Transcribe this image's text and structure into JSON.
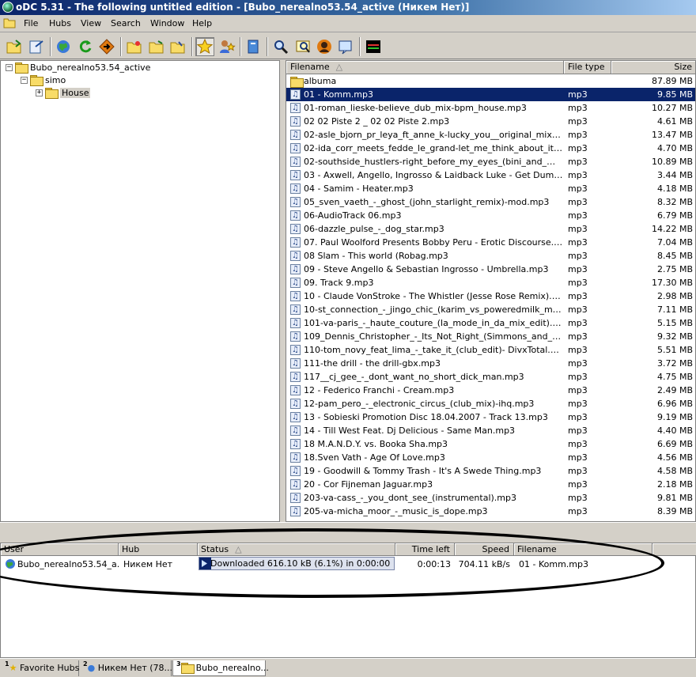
{
  "window": {
    "title": "oDC 5.31 - The following untitled edition - [Bubo_nerealno53.54_active (Никем Нет)]"
  },
  "menu": [
    "File",
    "Hubs",
    "View",
    "Search",
    "Window",
    "Help"
  ],
  "toolbar": {
    "buttons": [
      "connect-icon",
      "reconnect-icon",
      "public-hubs-icon",
      "refresh-icon",
      "follow-redirect-icon",
      "open-folder-icon",
      "open-file-list-icon",
      "open-own-list-icon",
      "favorite-hubs-icon",
      "favorite-users-icon",
      "queue-icon",
      "search-icon",
      "spy-icon",
      "avatar-icon",
      "notepad-icon",
      "network-stats-icon"
    ],
    "pressed": "favorite-hubs-icon"
  },
  "tree": {
    "root": "Bubo_nerealno53.54_active",
    "child": "simo",
    "grandchild": "House"
  },
  "files": {
    "headers": {
      "name": "Filename",
      "type": "File type",
      "size": "Size"
    },
    "rows": [
      {
        "name": "albuma",
        "type": "",
        "size": "87.89 MB",
        "folder": true
      },
      {
        "name": "01 - Komm.mp3",
        "type": "mp3",
        "size": "9.85 MB",
        "selected": true
      },
      {
        "name": "01-roman_lieske-believe_dub_mix-bpm_house.mp3",
        "type": "mp3",
        "size": "10.27 MB"
      },
      {
        "name": "02 02 Piste 2 _ 02 02 Piste 2.mp3",
        "type": "mp3",
        "size": "4.61 MB"
      },
      {
        "name": "02-asle_bjorn_pr_leya_ft_anne_k-lucky_you__original_mix-bpm_...",
        "type": "mp3",
        "size": "13.47 MB"
      },
      {
        "name": "02-ida_corr_meets_fedde_le_grand-let_me_think_about_it-(fedd...",
        "type": "mp3",
        "size": "4.70 MB"
      },
      {
        "name": "02-southside_hustlers-right_before_my_eyes_(bini_and_martini...",
        "type": "mp3",
        "size": "10.89 MB"
      },
      {
        "name": "03 - Axwell, Angello, Ingrosso & Laidback Luke - Get Dumb (Mark ...",
        "type": "mp3",
        "size": "3.44 MB"
      },
      {
        "name": "04 - Samim - Heater.mp3",
        "type": "mp3",
        "size": "4.18 MB"
      },
      {
        "name": "05_sven_vaeth_-_ghost_(john_starlight_remix)-mod.mp3",
        "type": "mp3",
        "size": "8.32 MB"
      },
      {
        "name": "06-AudioTrack 06.mp3",
        "type": "mp3",
        "size": "6.79 MB"
      },
      {
        "name": "06-dazzle_pulse_-_dog_star.mp3",
        "type": "mp3",
        "size": "14.22 MB"
      },
      {
        "name": "07. Paul Woolford Presents Bobby Peru - Erotic Discourse.mp3",
        "type": "mp3",
        "size": "7.04 MB"
      },
      {
        "name": "08 Slam - This world (Robag.mp3",
        "type": "mp3",
        "size": "8.45 MB"
      },
      {
        "name": "09 - Steve Angello & Sebastian Ingrosso - Umbrella.mp3",
        "type": "mp3",
        "size": "2.75 MB"
      },
      {
        "name": "09. Track 9.mp3",
        "type": "mp3",
        "size": "17.30 MB"
      },
      {
        "name": "10 - Claude VonStroke - The Whistler (Jesse Rose Remix).mp3",
        "type": "mp3",
        "size": "2.98 MB"
      },
      {
        "name": "10-st_connection_-_jingo_chic_(karim_vs_poweredmilk_mix)-ihq....",
        "type": "mp3",
        "size": "7.11 MB"
      },
      {
        "name": "101-va-paris_-_haute_couture_(la_mode_in_da_mix_edit).mp3",
        "type": "mp3",
        "size": "5.15 MB"
      },
      {
        "name": "109_Dennis_Christopher_-_Its_Not_Right_(Simmons_and_Christ...",
        "type": "mp3",
        "size": "9.32 MB"
      },
      {
        "name": "110-tom_novy_feat_lima_-_take_it_(club_edit)- DivxTotal.CoM....",
        "type": "mp3",
        "size": "5.51 MB"
      },
      {
        "name": "111-the drill - the drill-gbx.mp3",
        "type": "mp3",
        "size": "3.72 MB"
      },
      {
        "name": "117__cj_gee_-_dont_want_no_short_dick_man.mp3",
        "type": "mp3",
        "size": "4.75 MB"
      },
      {
        "name": "12 - Federico Franchi - Cream.mp3",
        "type": "mp3",
        "size": "2.49 MB"
      },
      {
        "name": "12-pam_pero_-_electronic_circus_(club_mix)-ihq.mp3",
        "type": "mp3",
        "size": "6.96 MB"
      },
      {
        "name": "13 - Sobieski Promotion Disc 18.04.2007 - Track 13.mp3",
        "type": "mp3",
        "size": "9.19 MB"
      },
      {
        "name": "14 - Till West Feat. Dj Delicious - Same Man.mp3",
        "type": "mp3",
        "size": "4.40 MB"
      },
      {
        "name": "18 M.A.N.D.Y. vs. Booka Sha.mp3",
        "type": "mp3",
        "size": "6.69 MB"
      },
      {
        "name": "18.Sven Vath - Age Of Love.mp3",
        "type": "mp3",
        "size": "4.56 MB"
      },
      {
        "name": "19 - Goodwill & Tommy Trash - It's A Swede Thing.mp3",
        "type": "mp3",
        "size": "4.58 MB"
      },
      {
        "name": "20 - Cor Fijneman Jaguar.mp3",
        "type": "mp3",
        "size": "2.18 MB"
      },
      {
        "name": "203-va-cass_-_you_dont_see_(instrumental).mp3",
        "type": "mp3",
        "size": "9.81 MB"
      },
      {
        "name": "205-va-micha_moor_-_music_is_dope.mp3",
        "type": "mp3",
        "size": "8.39 MB"
      }
    ]
  },
  "transfers": {
    "headers": {
      "user": "User",
      "hub": "Hub",
      "status": "Status",
      "time_left": "Time left",
      "speed": "Speed",
      "filename": "Filename"
    },
    "row": {
      "user": "Bubo_nerealno53.54_a...",
      "hub": "Никем Нет",
      "status": "Downloaded 616.10 kB (6.1%) in 0:00:00",
      "progress": 0.061,
      "time_left": "0:00:13",
      "speed": "704.11 kB/s",
      "filename": "01 - Komm.mp3"
    }
  },
  "tabs": [
    {
      "num": "1",
      "label": "Favorite Hubs",
      "icon": "star-icon"
    },
    {
      "num": "2",
      "label": "Никем Нет (78...",
      "icon": "hub-icon"
    },
    {
      "num": "3",
      "label": "Bubo_nerealno...",
      "icon": "folder-icon",
      "active": true
    }
  ],
  "colors": {
    "selection": "#0a246a",
    "face": "#d4d0c8",
    "title_start": "#0a246a",
    "title_end": "#a6caf0"
  }
}
